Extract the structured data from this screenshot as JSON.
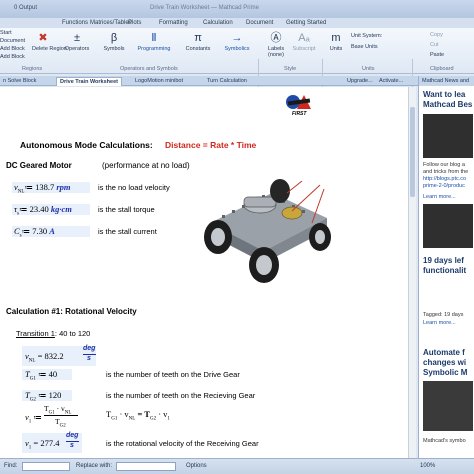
{
  "title": {
    "left": "0 Output",
    "right": "Drive Train Worksheet — Mathcad Prime"
  },
  "ribbon_tabs": [
    "Functions",
    "Matrices/Tables",
    "Plots",
    "Formatting",
    "Calculation",
    "Document",
    "Getting Started"
  ],
  "quick": {
    "row1": "Start",
    "row2": "Document",
    "row3": "Add Block",
    "row4": "Add Block"
  },
  "ribbon": {
    "delete_region": "Delete Region",
    "operators": "Operators",
    "symbols": "Symbols",
    "programming": "Programming",
    "constants": "Constants",
    "symbolics": "Symbolics",
    "labels": "Labels",
    "labels_sub": "(none)",
    "subscript": "Subscript",
    "units": "Units",
    "unit_system": "Unit System:",
    "base_units": "Base Units",
    "copy": "Copy",
    "cut": "Cut",
    "paste": "Paste",
    "group_regions": "Regions",
    "group_ops": "Operators and Symbols",
    "group_style": "Style",
    "group_units": "Units",
    "group_clip": "Clipboard"
  },
  "doc_tabs": [
    "n Solve Block",
    "Drive Train Worksheet",
    "LogoMotion minibot",
    "Turn Calculation",
    "Upgrade...",
    "Activate..."
  ],
  "right_panel": {
    "header": "Mathcad News and",
    "h1": "Want to lea",
    "h1b": "Mathcad Bes",
    "p1": "Follow our blog a",
    "p2": "and tricks from the",
    "p3": "http://blogs.ptc.co",
    "p4": "prime-2-0/produc",
    "more1": "Learn more...",
    "h2": "19 days lef",
    "h2b": "functionalit",
    "tag": "Tagged: 19 days",
    "more2": "Learn more...",
    "h3": "Automate f",
    "h3b": "changes wi",
    "h3c": "Symbolic M",
    "p5": "Mathcad's symbo"
  },
  "sheet": {
    "logo": "FIRST",
    "heading": "Autonomous Mode Calculations:",
    "formula": "Distance = Rate * Time",
    "motor_title": "DC Geared Motor",
    "motor_note": "(performance at no load)",
    "v_nl_lhs": "v",
    "v_nl_sub": "NL",
    "v_nl_val": "≔ 138.7",
    "v_nl_unit": "rpm",
    "v_nl_desc": "is the no load velocity",
    "ts_lhs": "τ",
    "ts_sub": "s",
    "ts_val": "≔ 23.40",
    "ts_unit": "kg·cm",
    "ts_desc": "is the stall torque",
    "cs_lhs": "C",
    "cs_sub": "s",
    "cs_val": "≔ 7.30",
    "cs_unit": "A",
    "cs_desc": "is the stall current",
    "calc1_title": "Calculation #1: Rotational Velocity",
    "transition": "Transition 1",
    "transition_rest": ": 40 to 120",
    "vnl2_lhs": "v",
    "vnl2_sub": "NL",
    "vnl2_val": "= 832.2",
    "vnl2_unit_top": "deg",
    "vnl2_unit_bot": "s",
    "tg1_lhs": "T",
    "tg1_sub": "G1",
    "tg1_val": "≔ 40",
    "tg1_desc": "is the number of teeth on the Drive Gear",
    "tg2_lhs": "T",
    "tg2_sub": "G2",
    "tg2_val": "≔ 120",
    "tg2_desc": "is the number of teeth on the Recieving Gear",
    "v1_lhs": "v",
    "v1_sub": "1",
    "v1_num": "T",
    "v1_num_sub": "G1",
    "v1_num2": " · v",
    "v1_num2_sub": "NL",
    "v1_den": "T",
    "v1_den_sub": "G2",
    "eq_lhs": "T",
    "eq_sub1": "G1",
    "eq_mid": " · v",
    "eq_sub2": "NL",
    "eq_op": " = T",
    "eq_sub3": "G2",
    "eq_end": " · v",
    "eq_sub4": "1",
    "v1b_lhs": "v",
    "v1b_sub": "1",
    "v1b_val": "= 277.4",
    "v1b_unit_top": "deg",
    "v1b_unit_bot": "s",
    "v1b_desc": "is the rotational velocity of the Receiving Gear"
  },
  "status": {
    "find": "Find:",
    "replace": "Replace with:",
    "options": "Options",
    "zoom": "100%"
  },
  "colors": {
    "accent": "#d0281e",
    "unit_blue": "#1c2fa8",
    "ribbon": "#dfe8f4"
  }
}
